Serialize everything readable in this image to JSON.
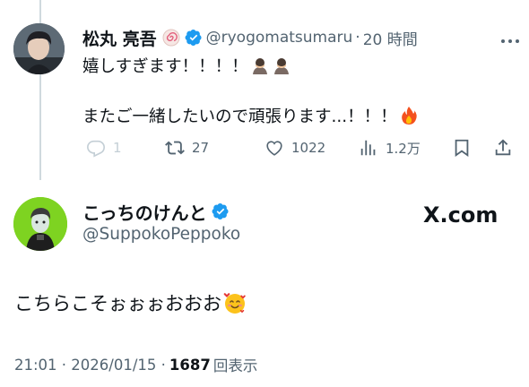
{
  "original_tweet": {
    "display_name": "松丸 亮吾",
    "handle": "@ryogomatsumaru",
    "separator": "·",
    "time_ago": "20 時間",
    "line1": "嬉しすぎます！！！！",
    "line2": "またご一緒したいので頑張ります...！！！",
    "icons": [
      "swirl-badge-icon",
      "verified-badge-icon",
      "bowing-person-icon",
      "fire-icon"
    ],
    "actions": {
      "reply_count": "1",
      "retweet_count": "27",
      "like_count": "1022",
      "views_count": "1.2万"
    }
  },
  "reply_tweet": {
    "display_name": "こっちのけんと",
    "handle": "@SuppokoPeppoko",
    "text": "こちらこそぉぉぉおおお",
    "icons": [
      "verified-badge-icon",
      "smiling-face-with-hearts-icon"
    ],
    "watermark": "X.com"
  },
  "footer": {
    "timestamp": "21:01 · 2026/01/15 ·",
    "views_count": "1687",
    "views_label": "回表示"
  },
  "colors": {
    "text_primary": "#0f1419",
    "text_secondary": "#536471",
    "verified_blue": "#1d9bf0",
    "thread_line": "#cfd9de"
  }
}
